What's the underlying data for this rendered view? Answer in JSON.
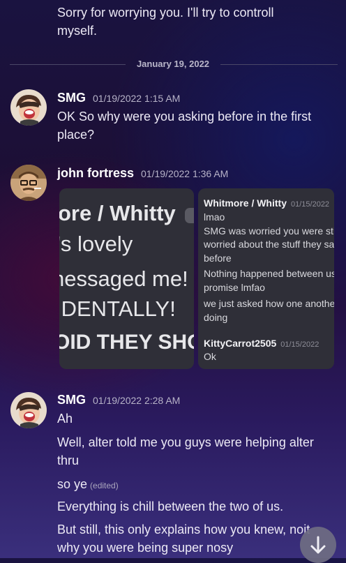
{
  "previous_message": {
    "lines": [
      "Sorry for worrying you. I'll try to controll",
      "myself."
    ]
  },
  "date_divider": "January 19, 2022",
  "messages": [
    {
      "author": "SMG",
      "timestamp": "01/19/2022 1:15 AM",
      "lines": [
        "OK So why were you asking before in the first",
        "place?"
      ]
    },
    {
      "author": "john fortress",
      "timestamp": "01/19/2022 1:36 AM",
      "attachments": {
        "left_crop_lines": [
          "ore / Whitty",
          "'s lovely",
          "nessaged me!",
          "IDENTALLY!",
          "OID THEY SHO"
        ],
        "right_screenshot": {
          "blocks": [
            {
              "name": "Whitmore / Whitty",
              "date": "01/15/2022",
              "lines": [
                "lmao",
                "SMG was worried you were sti",
                "worried about the stuff they sa",
                "before"
              ]
            },
            {
              "lines": [
                "Nothing happened between us",
                "promise lmfao"
              ]
            },
            {
              "lines": [
                "we just asked how one another",
                "doing"
              ]
            },
            {
              "name": "KittyCarrot2505",
              "date": "01/15/2022",
              "lines": [
                "Ok"
              ]
            }
          ]
        }
      }
    },
    {
      "author": "SMG",
      "timestamp": "01/19/2022 2:28 AM",
      "paragraphs": [
        {
          "lines": [
            "Ah"
          ]
        },
        {
          "lines": [
            "Well, alter told me you guys were helping alter",
            "thru"
          ]
        },
        {
          "lines": [
            "so ye"
          ],
          "edited": "(edited)"
        },
        {
          "lines": [
            "Everything is chill between the two of us."
          ]
        },
        {
          "lines": [
            "But still, this only explains how you knew, noit",
            "why you were being super nosy"
          ]
        }
      ]
    }
  ],
  "scroll_button": {
    "icon": "arrow-down-icon"
  }
}
